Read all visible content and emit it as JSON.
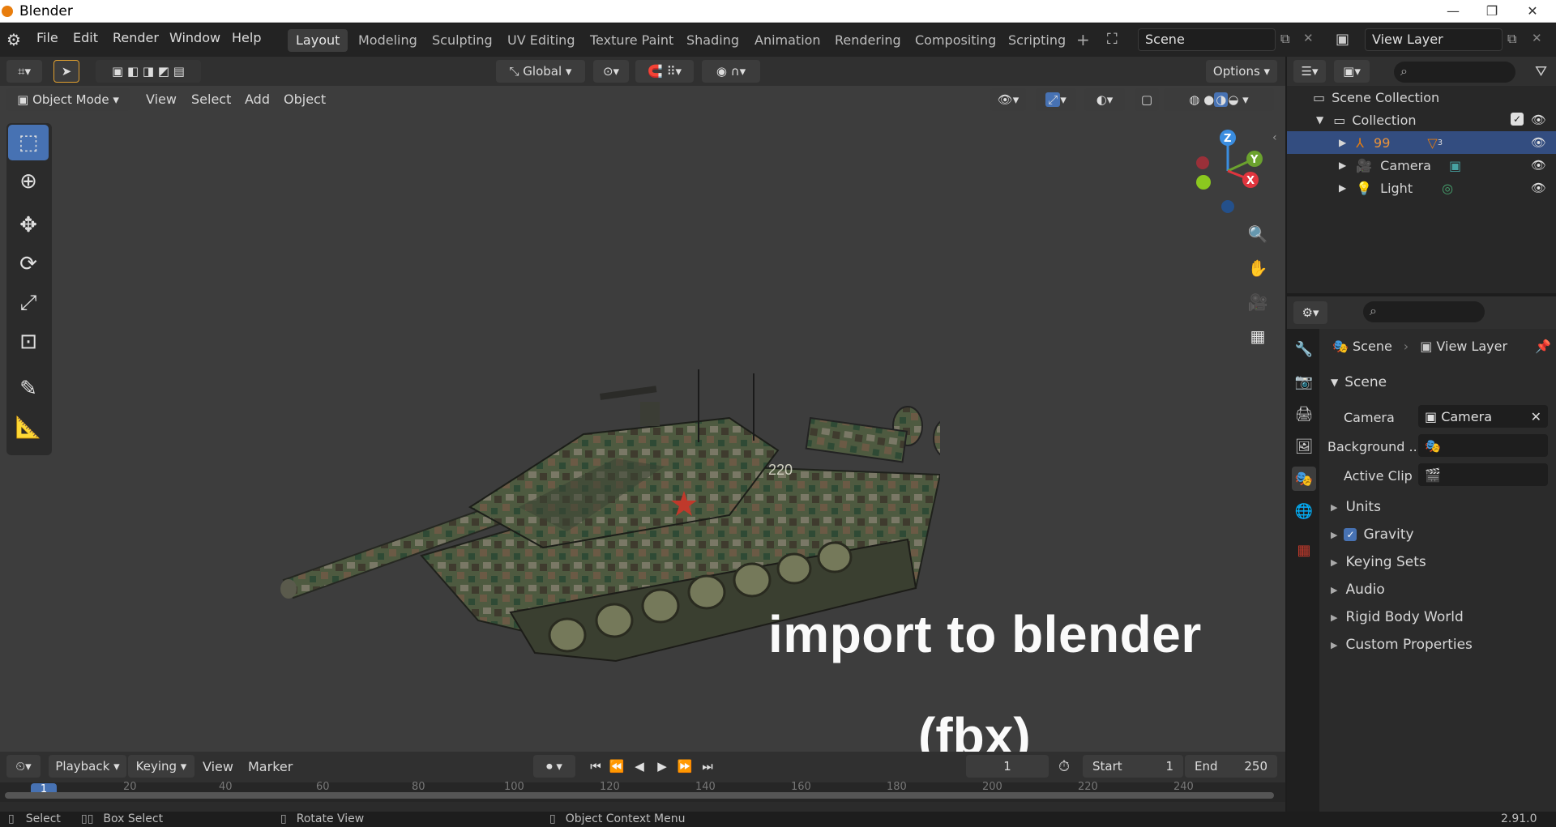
{
  "window": {
    "title": "Blender",
    "minimize": "—",
    "maximize": "❐",
    "close": "✕"
  },
  "menu": [
    "File",
    "Edit",
    "Render",
    "Window",
    "Help"
  ],
  "workspaces": [
    "Layout",
    "Modeling",
    "Sculpting",
    "UV Editing",
    "Texture Paint",
    "Shading",
    "Animation",
    "Rendering",
    "Compositing",
    "Scripting"
  ],
  "active_workspace": "Layout",
  "scene_name": "Scene",
  "view_layer_name": "View Layer",
  "viewport_header": {
    "transform_orientation": "Global",
    "options_label": "Options",
    "mode": "Object Mode",
    "menus": [
      "View",
      "Select",
      "Add",
      "Object"
    ]
  },
  "overlay_text": {
    "line1": "import to blender",
    "line2": "(fbx)"
  },
  "model": {
    "hull_number": "220"
  },
  "gizmo": {
    "x": "X",
    "y": "Y",
    "z": "Z",
    "x_color": "#e0353e",
    "y_color": "#6ba22e",
    "z_color": "#3a8de0"
  },
  "outliner": {
    "root": "Scene Collection",
    "collection": "Collection",
    "items": [
      {
        "name": "99",
        "badge": "3",
        "selected": true
      },
      {
        "name": "Camera",
        "selected": false
      },
      {
        "name": "Light",
        "selected": false
      }
    ]
  },
  "properties": {
    "breadcrumb_scene": "Scene",
    "breadcrumb_view_layer": "View Layer",
    "section_title": "Scene",
    "camera_label": "Camera",
    "camera_value": "Camera",
    "background_label": "Background ...",
    "active_clip_label": "Active Clip",
    "panels": [
      "Units",
      "Gravity",
      "Keying Sets",
      "Audio",
      "Rigid Body World",
      "Custom Properties"
    ],
    "gravity_checked": true
  },
  "timeline": {
    "menus": [
      "Playback",
      "Keying",
      "View",
      "Marker"
    ],
    "current_frame": "1",
    "start_label": "Start",
    "start_value": "1",
    "end_label": "End",
    "end_value": "250",
    "ruler_marks": [
      "1",
      "20",
      "40",
      "60",
      "80",
      "100",
      "120",
      "140",
      "160",
      "180",
      "200",
      "220",
      "240"
    ]
  },
  "statusbar": {
    "select": "Select",
    "box_select": "Box Select",
    "rotate_view": "Rotate View",
    "context_menu": "Object Context Menu",
    "version": "2.91.0"
  }
}
